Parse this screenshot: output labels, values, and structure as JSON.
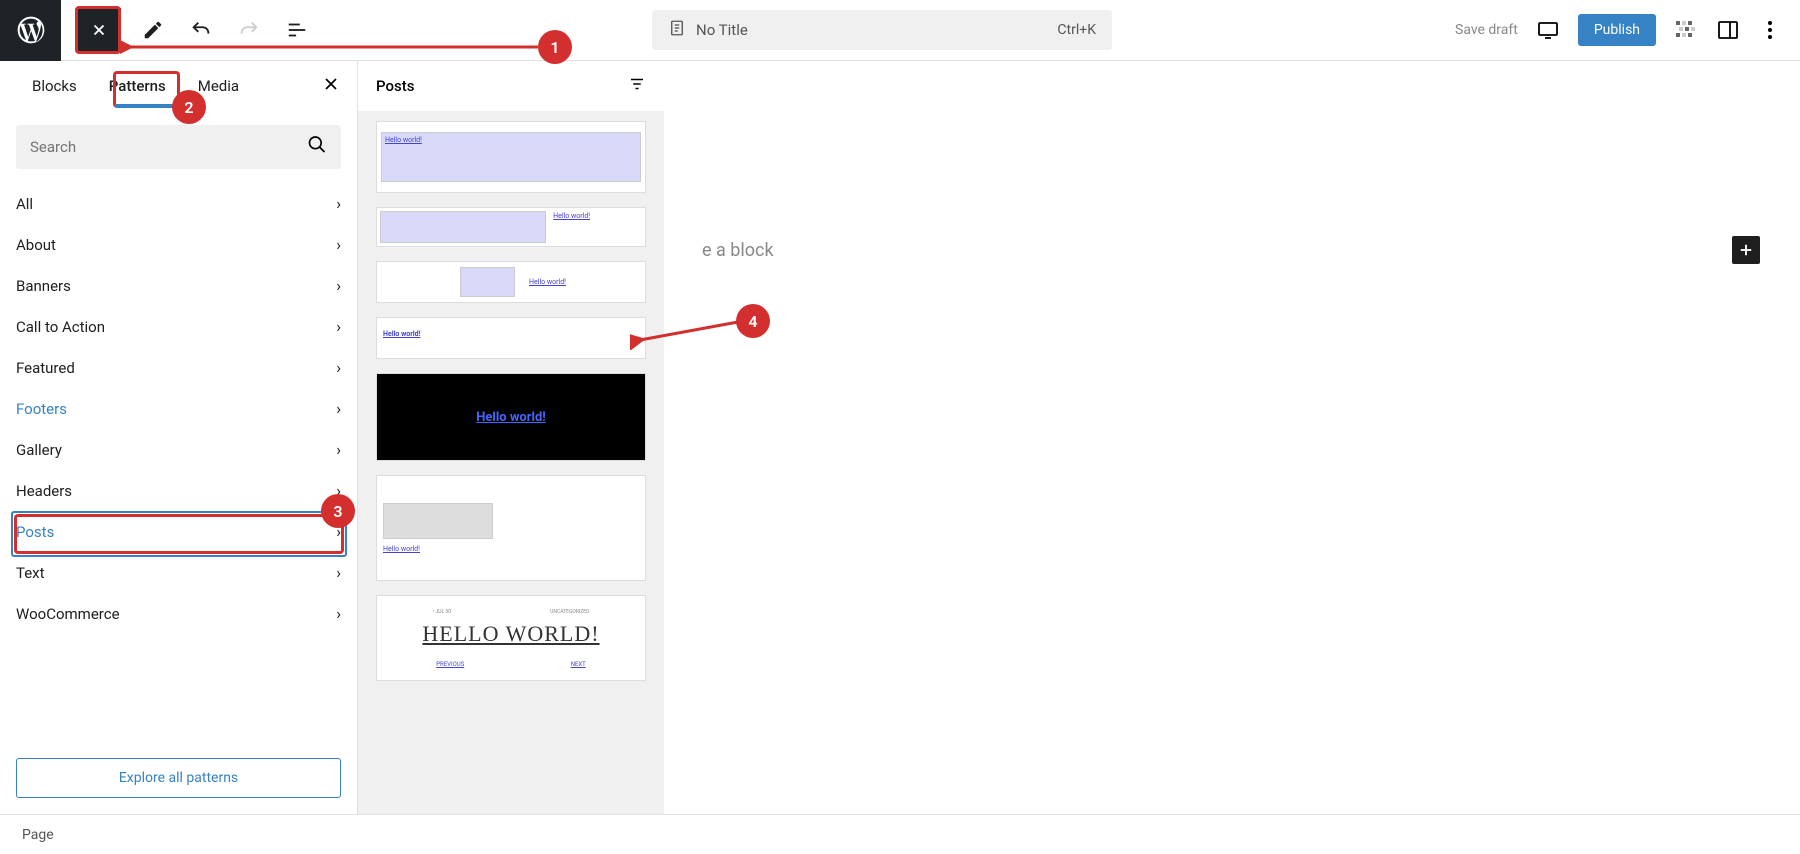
{
  "toolbar": {
    "title": "No Title",
    "shortcut": "Ctrl+K",
    "save_draft": "Save draft",
    "publish": "Publish"
  },
  "inserter": {
    "tabs": {
      "blocks": "Blocks",
      "patterns": "Patterns",
      "media": "Media"
    },
    "search_placeholder": "Search",
    "categories": [
      {
        "label": "All",
        "highlight": false
      },
      {
        "label": "About",
        "highlight": false
      },
      {
        "label": "Banners",
        "highlight": false
      },
      {
        "label": "Call to Action",
        "highlight": false
      },
      {
        "label": "Featured",
        "highlight": false
      },
      {
        "label": "Footers",
        "highlight": true
      },
      {
        "label": "Gallery",
        "highlight": false
      },
      {
        "label": "Headers",
        "highlight": false
      },
      {
        "label": "Posts",
        "highlight": true
      },
      {
        "label": "Text",
        "highlight": false
      },
      {
        "label": "WooCommerce",
        "highlight": false
      }
    ],
    "explore": "Explore all patterns"
  },
  "patterns": {
    "title": "Posts",
    "thumbs": {
      "hello_world": "Hello world!",
      "hello_world_caps": "HELLO WORLD!",
      "previous": "PREVIOUS",
      "next": "NEXT",
      "uncategorized": "UNCATEGORIZED"
    }
  },
  "canvas": {
    "placeholder": "e a block"
  },
  "bottom": {
    "breadcrumb": "Page"
  },
  "annotations": {
    "n1": "1",
    "n2": "2",
    "n3": "3",
    "n4": "4"
  }
}
